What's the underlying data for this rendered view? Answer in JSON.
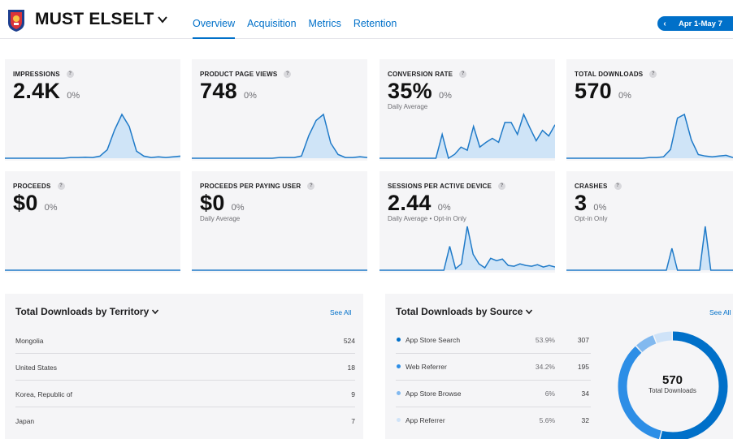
{
  "header": {
    "app_title": "MUST ELSELT",
    "tabs": [
      {
        "label": "Overview",
        "active": true
      },
      {
        "label": "Acquisition",
        "active": false
      },
      {
        "label": "Metrics",
        "active": false
      },
      {
        "label": "Retention",
        "active": false
      }
    ],
    "date_range": "Apr 1-May 7"
  },
  "metrics": [
    {
      "label": "IMPRESSIONS",
      "value": "2.4K",
      "change": "0%",
      "sub": "",
      "series": [
        0,
        0,
        0,
        0,
        0,
        0,
        0,
        0,
        0,
        1,
        1,
        1.5,
        1,
        3,
        12,
        40,
        62,
        45,
        10,
        3,
        1,
        2,
        1,
        2,
        3
      ]
    },
    {
      "label": "PRODUCT PAGE VIEWS",
      "value": "748",
      "change": "0%",
      "sub": "",
      "series": [
        0,
        0,
        0,
        0,
        0,
        0,
        0,
        0,
        0,
        0,
        0,
        0,
        1,
        1,
        1,
        3,
        30,
        50,
        58,
        20,
        5,
        1,
        1,
        2,
        1
      ]
    },
    {
      "label": "CONVERSION RATE",
      "value": "35%",
      "change": "0%",
      "sub": "Daily Average",
      "series": [
        0,
        0,
        0,
        0,
        0,
        0,
        0,
        0,
        0,
        0,
        30,
        0,
        5,
        14,
        10,
        40,
        14,
        20,
        25,
        20,
        45,
        45,
        30,
        55,
        38,
        22,
        35,
        28,
        42
      ]
    },
    {
      "label": "TOTAL DOWNLOADS",
      "value": "570",
      "change": "0%",
      "sub": "",
      "series": [
        0,
        0,
        0,
        0,
        0,
        0,
        0,
        0,
        0,
        0,
        0,
        0,
        1,
        1,
        2,
        12,
        55,
        60,
        25,
        5,
        3,
        2,
        3,
        4,
        1
      ]
    },
    {
      "label": "PROCEEDS",
      "value": "$0",
      "change": "0%",
      "sub": "",
      "series": [
        0,
        0,
        0,
        0,
        0,
        0,
        0,
        0,
        0,
        0,
        0,
        0,
        0,
        0,
        0,
        0,
        0,
        0,
        0,
        0,
        0,
        0,
        0,
        0,
        0
      ]
    },
    {
      "label": "PROCEEDS PER PAYING USER",
      "value": "$0",
      "change": "0%",
      "sub": "Daily Average",
      "series": [
        0,
        0,
        0,
        0,
        0,
        0,
        0,
        0,
        0,
        0,
        0,
        0,
        0,
        0,
        0,
        0,
        0,
        0,
        0,
        0,
        0,
        0,
        0,
        0,
        0
      ]
    },
    {
      "label": "SESSIONS PER ACTIVE DEVICE",
      "value": "2.44",
      "change": "0%",
      "sub": "Daily Average • Opt-in Only",
      "series": [
        0,
        0,
        0,
        0,
        0,
        0,
        0,
        0,
        0,
        0,
        0,
        0,
        30,
        2,
        8,
        55,
        20,
        8,
        3,
        15,
        12,
        14,
        6,
        5,
        8,
        6,
        5,
        7,
        4,
        6,
        4
      ]
    },
    {
      "label": "CRASHES",
      "value": "3",
      "change": "0%",
      "sub": "Opt-in Only",
      "series": [
        0,
        0,
        0,
        0,
        0,
        0,
        0,
        0,
        0,
        0,
        0,
        0,
        0,
        0,
        0,
        0,
        0,
        0,
        0,
        1,
        0,
        0,
        0,
        0,
        0,
        2,
        0,
        0,
        0,
        0,
        0
      ]
    }
  ],
  "territory": {
    "title": "Total Downloads by Territory",
    "see_all": "See All",
    "rows": [
      {
        "name": "Mongolia",
        "value": "524"
      },
      {
        "name": "United States",
        "value": "18"
      },
      {
        "name": "Korea, Republic of",
        "value": "9"
      },
      {
        "name": "Japan",
        "value": "7"
      }
    ]
  },
  "source": {
    "title": "Total Downloads by Source",
    "see_all": "See All",
    "rows": [
      {
        "name": "App Store Search",
        "pct": "53.9%",
        "count": "307",
        "color": "#0070c9"
      },
      {
        "name": "Web Referrer",
        "pct": "34.2%",
        "count": "195",
        "color": "#2d8ee6"
      },
      {
        "name": "App Store Browse",
        "pct": "6%",
        "count": "34",
        "color": "#82b9ef"
      },
      {
        "name": "App Referrer",
        "pct": "5.6%",
        "count": "32",
        "color": "#cfe3f8"
      }
    ],
    "donut": {
      "value": "570",
      "label": "Total Downloads",
      "shares": [
        53.9,
        34.2,
        6,
        5.6
      ]
    }
  },
  "colors": {
    "accent": "#0070c9",
    "card_bg": "#f5f5f7",
    "line": "#1f7ac8",
    "fill": "#cfe4f7"
  }
}
